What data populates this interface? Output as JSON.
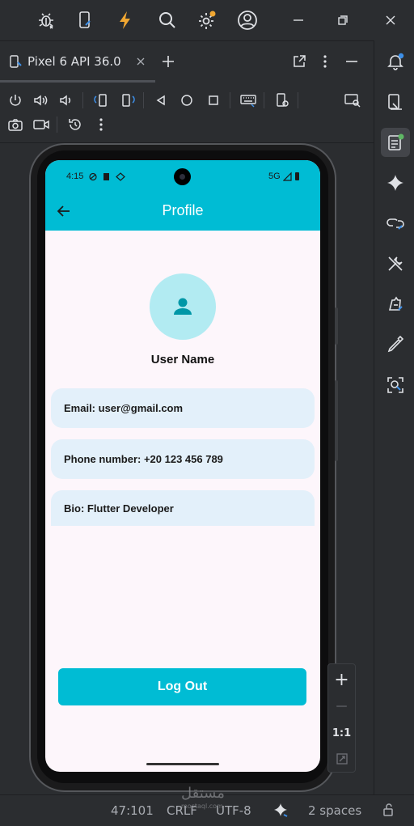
{
  "toolbar": {
    "icons": [
      "debug-bug-icon",
      "apply-changes-icon",
      "flash-icon",
      "search-icon",
      "settings-gear-icon",
      "account-icon",
      "minimize-icon",
      "restore-icon",
      "close-icon"
    ],
    "notification_dot_color": "#f0a732"
  },
  "tab": {
    "label": "Pixel 6 API 36.0"
  },
  "device": {
    "status_time": "4:15",
    "network": "5G"
  },
  "app": {
    "title": "Profile",
    "user_name": "User Name",
    "email": "Email: user@gmail.com",
    "phone": "Phone number: +20 123 456 789",
    "bio": "Bio: Flutter Developer",
    "logout_label": "Log Out",
    "accent": "#00bcd4",
    "avatar_bg": "#b2ebf2",
    "card_bg": "#e3f0fa"
  },
  "zoom": {
    "plus": "+",
    "minus": "—",
    "ratio": "1:1"
  },
  "statusbar": {
    "position": "47:101",
    "line_ending": "CRLF",
    "encoding": "UTF-8",
    "indent": "2 spaces"
  },
  "watermark": {
    "text": "مستقل",
    "sub": "mostaql.com"
  }
}
